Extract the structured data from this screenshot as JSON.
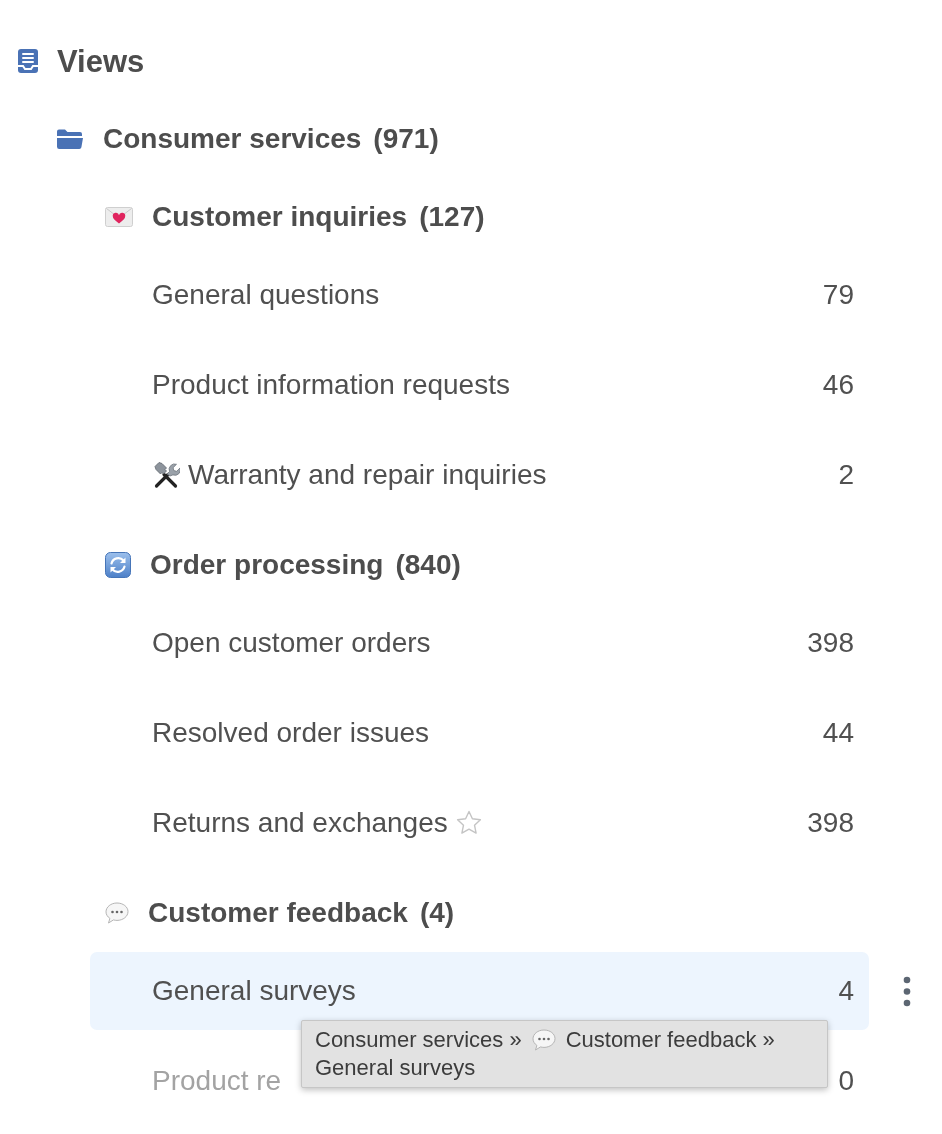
{
  "header": {
    "title": "Views"
  },
  "tree": [
    {
      "label": "Consumer services",
      "count": "(971)",
      "children": [
        {
          "label": "Customer inquiries",
          "count": "(127)",
          "children": [
            {
              "kind": "plain",
              "label": "General questions",
              "count": "79",
              "selected": false,
              "muted": false
            },
            {
              "kind": "plain",
              "label": "Product information requests",
              "count": "46",
              "selected": false,
              "muted": false
            },
            {
              "kind": "emoji",
              "label": "Warranty and repair inquiries",
              "count": "2",
              "selected": false,
              "muted": false
            }
          ]
        },
        {
          "label": "Order processing",
          "count": "(840)",
          "children": [
            {
              "kind": "plain",
              "label": "Open customer orders",
              "count": "398",
              "selected": false,
              "muted": false
            },
            {
              "kind": "plain",
              "label": "Resolved order issues",
              "count": "44",
              "selected": false,
              "muted": false
            },
            {
              "kind": "plain",
              "label": "Returns and exchanges",
              "count": "398",
              "starred": false,
              "selected": false,
              "muted": false
            }
          ]
        },
        {
          "label": "Customer feedback",
          "count": "(4)",
          "children": [
            {
              "kind": "plain",
              "label": "General surveys",
              "count": "4",
              "selected": true,
              "muted": false
            },
            {
              "kind": "plain",
              "label": "Product re",
              "count": "0",
              "selected": false,
              "muted": true
            }
          ]
        }
      ]
    }
  ],
  "tooltip": {
    "parts": [
      {
        "kind": "plain",
        "text": "Consumer services »"
      },
      {
        "kind": "emoji",
        "text": "Customer feedback »"
      },
      {
        "kind": "plain",
        "text": "General surveys"
      }
    ]
  }
}
